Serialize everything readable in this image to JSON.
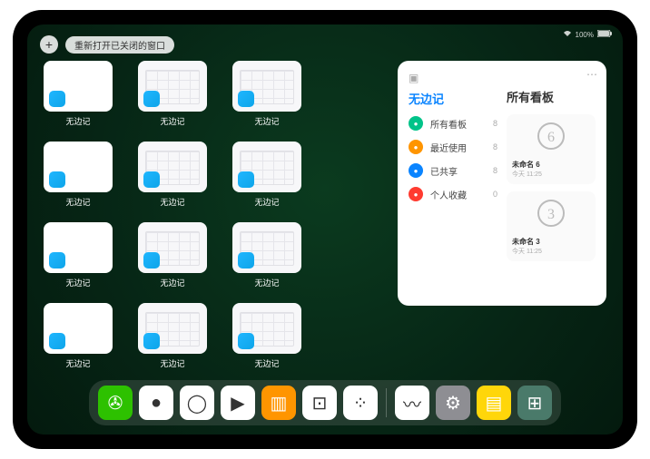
{
  "statusbar": {
    "batteryText": "100%"
  },
  "topbar": {
    "addLabel": "+",
    "tabLabel": "重新打开已关闭的窗口"
  },
  "appLabel": "无边记",
  "grid": {
    "rows": [
      [
        "plain",
        "cal",
        "cal"
      ],
      [
        "plain",
        "cal",
        "cal"
      ],
      [
        "plain",
        "cal",
        "cal"
      ],
      [
        "plain",
        "cal",
        "cal"
      ]
    ]
  },
  "largeWindow": {
    "title": "无边记",
    "rightTitle": "所有看板",
    "items": [
      {
        "icon": "grid-icon",
        "color": "#00c389",
        "label": "所有看板",
        "count": "8"
      },
      {
        "icon": "clock-icon",
        "color": "#ff9500",
        "label": "最近使用",
        "count": "8"
      },
      {
        "icon": "people-icon",
        "color": "#0a84ff",
        "label": "已共享",
        "count": "8"
      },
      {
        "icon": "heart-icon",
        "color": "#ff3b30",
        "label": "个人收藏",
        "count": "0"
      }
    ],
    "boards": [
      {
        "name": "未命名 6",
        "glyph": "6",
        "time": "今天 11:25"
      },
      {
        "name": "未命名 3",
        "glyph": "3",
        "time": "今天 11:25"
      }
    ]
  },
  "dock": {
    "icons": [
      {
        "name": "wechat-icon",
        "bg": "#2dc100",
        "glyph": "✇"
      },
      {
        "name": "browser-icon",
        "bg": "#ffffff",
        "glyph": "●"
      },
      {
        "name": "qqbrowser-icon",
        "bg": "#ffffff",
        "glyph": "◯"
      },
      {
        "name": "play-icon",
        "bg": "#ffffff",
        "glyph": "▶"
      },
      {
        "name": "books-icon",
        "bg": "#ff9500",
        "glyph": "▥"
      },
      {
        "name": "dice-icon",
        "bg": "#ffffff",
        "glyph": "⊡"
      },
      {
        "name": "dots-icon",
        "bg": "#ffffff",
        "glyph": "⁘"
      },
      {
        "name": "freeform-icon",
        "bg": "#ffffff",
        "glyph": "〰"
      },
      {
        "name": "settings-icon",
        "bg": "#8e8e93",
        "glyph": "⚙"
      },
      {
        "name": "notes-icon",
        "bg": "#ffd60a",
        "glyph": "▤"
      },
      {
        "name": "appgroup-icon",
        "bg": "#4a7a6a",
        "glyph": "⊞"
      }
    ],
    "separatorAfter": 6
  }
}
